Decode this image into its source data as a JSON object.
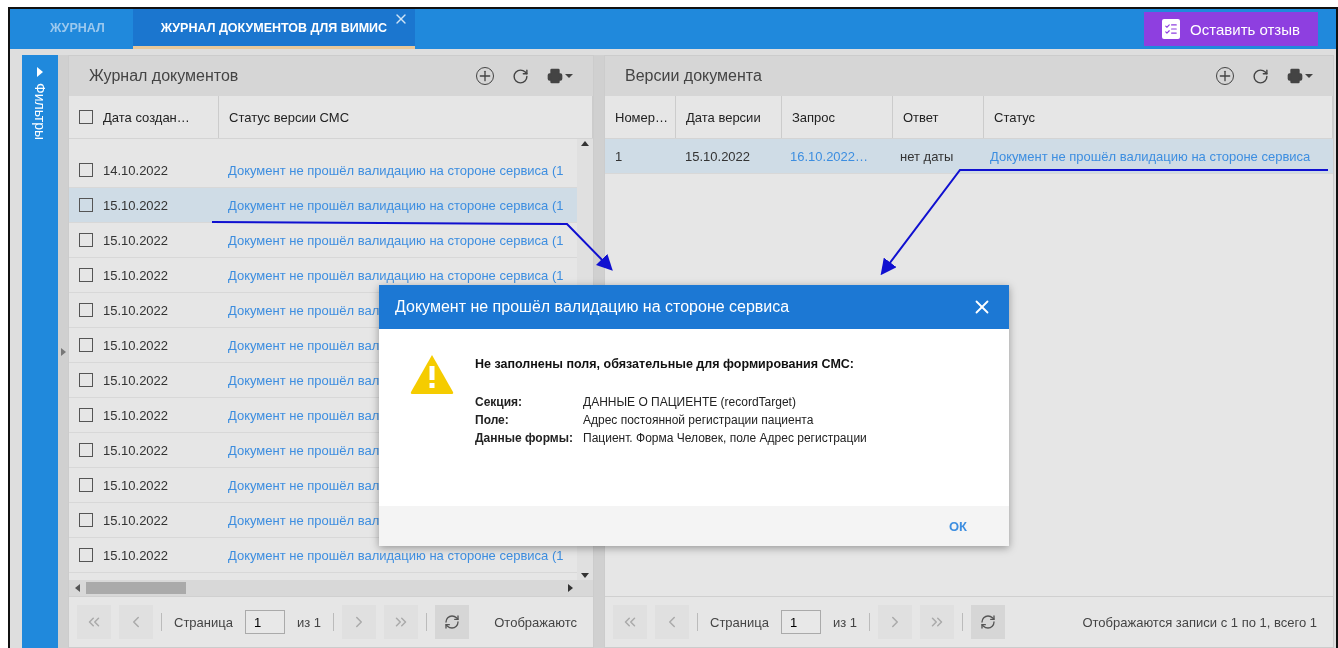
{
  "tabs": [
    {
      "label": "ЖУРНАЛ",
      "selected": false,
      "closable": false
    },
    {
      "label": "ЖУРНАЛ ДОКУМЕНТОВ ДЛЯ ВИМИС",
      "selected": true,
      "closable": true
    }
  ],
  "feedback_button": "Оставить отзыв",
  "filters_label": "Фильтры",
  "left_panel": {
    "title": "Журнал документов",
    "all_checked": false,
    "columns": [
      "Дата создан…",
      "Статус версии СМС"
    ],
    "rows": [
      {
        "checked": false,
        "selected": false,
        "date": "14.10.2022",
        "status": "Документ не прошёл валидацию на стороне сервиса (1"
      },
      {
        "checked": false,
        "selected": true,
        "date": "15.10.2022",
        "status": "Документ не прошёл валидацию на стороне сервиса (1"
      },
      {
        "checked": false,
        "selected": false,
        "date": "15.10.2022",
        "status": "Документ не прошёл валидацию на стороне сервиса (1"
      },
      {
        "checked": false,
        "selected": false,
        "date": "15.10.2022",
        "status": "Документ не прошёл валидацию на стороне сервиса (1"
      },
      {
        "checked": false,
        "selected": false,
        "date": "15.10.2022",
        "status": "Документ не прошёл вал"
      },
      {
        "checked": false,
        "selected": false,
        "date": "15.10.2022",
        "status": "Документ не прошёл вал"
      },
      {
        "checked": false,
        "selected": false,
        "date": "15.10.2022",
        "status": "Документ не прошёл вал"
      },
      {
        "checked": false,
        "selected": false,
        "date": "15.10.2022",
        "status": "Документ не прошёл вал"
      },
      {
        "checked": false,
        "selected": false,
        "date": "15.10.2022",
        "status": "Документ не прошёл вал"
      },
      {
        "checked": false,
        "selected": false,
        "date": "15.10.2022",
        "status": "Документ не прошёл вал"
      },
      {
        "checked": false,
        "selected": false,
        "date": "15.10.2022",
        "status": "Документ не прошёл вал"
      },
      {
        "checked": false,
        "selected": false,
        "date": "15.10.2022",
        "status": "Документ не прошёл валидацию на стороне сервиса (1"
      }
    ],
    "footer": {
      "page_label": "Страница",
      "page": "1",
      "of": "из 1",
      "info": "Отображаютс"
    }
  },
  "right_panel": {
    "title": "Версии документа",
    "columns": [
      "Номер…",
      "Дата версии",
      "Запрос",
      "Ответ",
      "Статус"
    ],
    "rows": [
      {
        "selected": true,
        "number": "1",
        "date": "15.10.2022",
        "request": "16.10.2022…",
        "response": "нет даты",
        "status": "Документ не прошёл валидацию на стороне сервиса"
      }
    ],
    "footer": {
      "page_label": "Страница",
      "page": "1",
      "of": "из 1",
      "info": "Отображаются записи с 1 по 1, всего 1"
    }
  },
  "dialog": {
    "title": "Документ не прошёл валидацию на стороне сервиса",
    "message": "Не заполнены поля, обязательные для формирования СМС:",
    "fields": [
      {
        "label": "Секция:",
        "value": "ДАННЫЕ О ПАЦИЕНТЕ (recordTarget)"
      },
      {
        "label": "Поле:",
        "value": "Адрес постоянной регистрации пациента"
      },
      {
        "label": "Данные формы:",
        "value": "Пациент. Форма Человек, поле Адрес регистрации"
      }
    ],
    "ok": "ОК"
  }
}
